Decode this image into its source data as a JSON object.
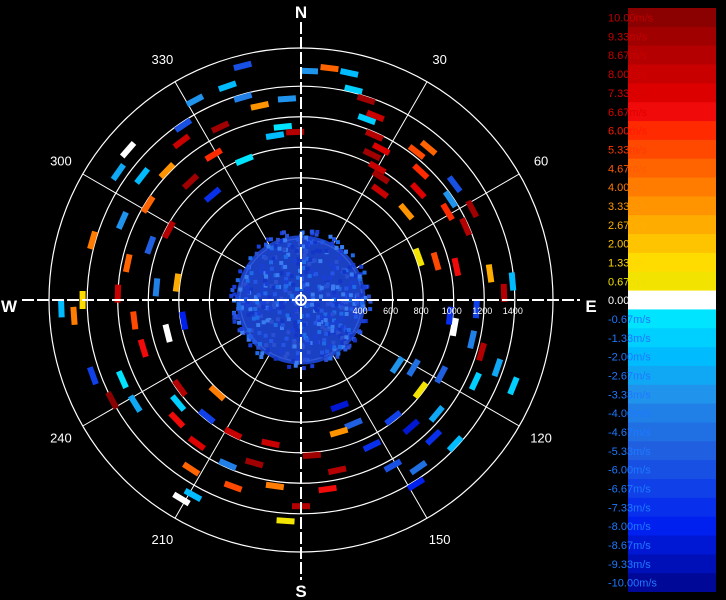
{
  "chart_data": {
    "type": "polar-scatter",
    "title": "",
    "cardinal_labels": {
      "north": "N",
      "east": "E",
      "south": "S",
      "west": "W"
    },
    "bearing_labels": [
      "30",
      "60",
      "120",
      "150",
      "210",
      "240",
      "300",
      "330"
    ],
    "bearing_values": [
      30,
      60,
      120,
      150,
      210,
      240,
      300,
      330
    ],
    "range_labels": [
      "400",
      "600",
      "800",
      "1000",
      "1200",
      "1400"
    ],
    "range_values": [
      400,
      600,
      800,
      1000,
      1200,
      1400
    ],
    "range_max": 1650,
    "grid": true,
    "colorbar": {
      "placement": "right",
      "labels": [
        "10.00m/s",
        "9.33m/s",
        "8.67m/s",
        "8.00m/s",
        "7.33m/s",
        "6.67m/s",
        "6.00m/s",
        "5.33m/s",
        "4.67m/s",
        "4.00m/s",
        "3.33m/s",
        "2.67m/s",
        "2.00m/s",
        "1.33m/s",
        "0.67m/s",
        "0.00m/s",
        "-0.67m/s",
        "-1.33m/s",
        "-2.00m/s",
        "-2.67m/s",
        "-3.33m/s",
        "-4.00m/s",
        "-4.67m/s",
        "-5.33m/s",
        "-6.00m/s",
        "-6.67m/s",
        "-7.33m/s",
        "-8.00m/s",
        "-8.67m/s",
        "-9.33m/s",
        "-10.00m/s"
      ],
      "colors": [
        "#8b0000",
        "#a00000",
        "#b40000",
        "#c80000",
        "#dc0000",
        "#f00a0a",
        "#ff2a00",
        "#ff4800",
        "#ff6400",
        "#ff7c00",
        "#ff9400",
        "#ffac00",
        "#ffc400",
        "#ffdc00",
        "#f2e400",
        "#ffffff",
        "#00e4ff",
        "#00d0ff",
        "#00bcff",
        "#10a8f4",
        "#2094ec",
        "#2080e8",
        "#2070e4",
        "#2060e0",
        "#1850e4",
        "#1040e8",
        "#0830ec",
        "#0020f0",
        "#0018d4",
        "#0010b8",
        "#000898"
      ]
    },
    "clutter_radius": 460,
    "gates": [
      {
        "az": 2,
        "r": 1500,
        "v": -3.3
      },
      {
        "az": 7,
        "r": 1530,
        "v": 5.0
      },
      {
        "az": 12,
        "r": 1520,
        "v": -2.2
      },
      {
        "az": 14,
        "r": 1420,
        "v": -1.5
      },
      {
        "az": 18,
        "r": 1380,
        "v": 9.5
      },
      {
        "az": 20,
        "r": 1260,
        "v": -1.4
      },
      {
        "az": 22,
        "r": 1300,
        "v": 7.8
      },
      {
        "az": 24,
        "r": 1180,
        "v": 8.9
      },
      {
        "az": 26,
        "r": 1060,
        "v": 9.1
      },
      {
        "az": 28,
        "r": 1120,
        "v": 7.2
      },
      {
        "az": 30,
        "r": 1000,
        "v": 8.3
      },
      {
        "az": 33,
        "r": 960,
        "v": 9.4
      },
      {
        "az": 36,
        "r": 880,
        "v": 8.1
      },
      {
        "az": 38,
        "r": 1230,
        "v": 5.4
      },
      {
        "az": 40,
        "r": 1300,
        "v": 4.6
      },
      {
        "az": 43,
        "r": 1150,
        "v": 6.2
      },
      {
        "az": 47,
        "r": 1050,
        "v": 7.6
      },
      {
        "az": 50,
        "r": 900,
        "v": 3.6
      },
      {
        "az": 53,
        "r": 1260,
        "v": -6.3
      },
      {
        "az": 56,
        "r": 1180,
        "v": -3.2
      },
      {
        "az": 59,
        "r": 1120,
        "v": 6.0
      },
      {
        "az": 62,
        "r": 1270,
        "v": 9.2
      },
      {
        "az": 66,
        "r": 1180,
        "v": 8.5
      },
      {
        "az": 70,
        "r": 820,
        "v": 0.6
      },
      {
        "az": 74,
        "r": 920,
        "v": 5.2
      },
      {
        "az": 78,
        "r": 1040,
        "v": 7.0
      },
      {
        "az": 82,
        "r": 1250,
        "v": 3.0
      },
      {
        "az": 85,
        "r": 1390,
        "v": -2.1
      },
      {
        "az": 88,
        "r": 1330,
        "v": 9.0
      },
      {
        "az": 93,
        "r": 1150,
        "v": -6.6
      },
      {
        "az": 96,
        "r": 980,
        "v": -7.1
      },
      {
        "az": 100,
        "r": 1020,
        "v": 0.0
      },
      {
        "az": 103,
        "r": 1150,
        "v": -4.1
      },
      {
        "az": 106,
        "r": 1230,
        "v": 8.4
      },
      {
        "az": 109,
        "r": 1360,
        "v": -2.4
      },
      {
        "az": 112,
        "r": 1500,
        "v": -1.3
      },
      {
        "az": 115,
        "r": 1260,
        "v": -1.6
      },
      {
        "az": 118,
        "r": 1040,
        "v": -5.1
      },
      {
        "az": 121,
        "r": 860,
        "v": -4.7
      },
      {
        "az": 124,
        "r": 760,
        "v": -3.0
      },
      {
        "az": 127,
        "r": 980,
        "v": 0.8
      },
      {
        "az": 130,
        "r": 1160,
        "v": -2.8
      },
      {
        "az": 133,
        "r": 1380,
        "v": -2.0
      },
      {
        "az": 136,
        "r": 1250,
        "v": -7.4
      },
      {
        "az": 139,
        "r": 1100,
        "v": -8.6
      },
      {
        "az": 142,
        "r": 980,
        "v": -6.7
      },
      {
        "az": 145,
        "r": 1340,
        "v": -4.4
      },
      {
        "az": 148,
        "r": 1420,
        "v": -8.1
      },
      {
        "az": 151,
        "r": 1240,
        "v": -6.2
      },
      {
        "az": 154,
        "r": 1060,
        "v": -7.6
      },
      {
        "az": 157,
        "r": 880,
        "v": -5.0
      },
      {
        "az": 160,
        "r": 740,
        "v": -8.8
      },
      {
        "az": 164,
        "r": 900,
        "v": 3.4
      },
      {
        "az": 168,
        "r": 1140,
        "v": 8.6
      },
      {
        "az": 172,
        "r": 1250,
        "v": 6.4
      },
      {
        "az": 176,
        "r": 1020,
        "v": 9.2
      },
      {
        "az": 180,
        "r": 1350,
        "v": 8.9
      },
      {
        "az": 184,
        "r": 1450,
        "v": 1.0
      },
      {
        "az": 188,
        "r": 1230,
        "v": 4.0
      },
      {
        "az": 192,
        "r": 960,
        "v": 7.7
      },
      {
        "az": 196,
        "r": 1110,
        "v": 9.6
      },
      {
        "az": 200,
        "r": 1300,
        "v": 5.6
      },
      {
        "az": 204,
        "r": 1180,
        "v": -4.2
      },
      {
        "az": 207,
        "r": 980,
        "v": 8.2
      },
      {
        "az": 209,
        "r": 1460,
        "v": -1.9
      },
      {
        "az": 211,
        "r": 1520,
        "v": 0.0
      },
      {
        "az": 213,
        "r": 1320,
        "v": 4.8
      },
      {
        "az": 216,
        "r": 1160,
        "v": 7.4
      },
      {
        "az": 219,
        "r": 980,
        "v": -6.8
      },
      {
        "az": 222,
        "r": 820,
        "v": 4.2
      },
      {
        "az": 226,
        "r": 1130,
        "v": 6.6
      },
      {
        "az": 230,
        "r": 1050,
        "v": -1.0
      },
      {
        "az": 234,
        "r": 980,
        "v": 8.7
      },
      {
        "az": 238,
        "r": 1280,
        "v": -2.6
      },
      {
        "az": 242,
        "r": 1400,
        "v": 9.8
      },
      {
        "az": 246,
        "r": 1280,
        "v": -0.8
      },
      {
        "az": 250,
        "r": 1450,
        "v": -6.5
      },
      {
        "az": 253,
        "r": 1080,
        "v": 6.9
      },
      {
        "az": 256,
        "r": 900,
        "v": 0.2
      },
      {
        "az": 260,
        "r": 780,
        "v": -7.8
      },
      {
        "az": 263,
        "r": 1100,
        "v": 5.1
      },
      {
        "az": 266,
        "r": 1490,
        "v": 3.8
      },
      {
        "az": 268,
        "r": 1570,
        "v": -2.0
      },
      {
        "az": 270,
        "r": 1430,
        "v": 1.6
      },
      {
        "az": 272,
        "r": 1200,
        "v": 7.9
      },
      {
        "az": 275,
        "r": 950,
        "v": -3.9
      },
      {
        "az": 278,
        "r": 820,
        "v": 2.8
      },
      {
        "az": 282,
        "r": 1160,
        "v": 4.5
      },
      {
        "az": 286,
        "r": 1420,
        "v": 3.9
      },
      {
        "az": 290,
        "r": 1050,
        "v": -5.6
      },
      {
        "az": 294,
        "r": 1280,
        "v": -3.6
      },
      {
        "az": 298,
        "r": 980,
        "v": 8.8
      },
      {
        "az": 302,
        "r": 1180,
        "v": 4.9
      },
      {
        "az": 305,
        "r": 1460,
        "v": -2.9
      },
      {
        "az": 308,
        "r": 1320,
        "v": -1.7
      },
      {
        "az": 311,
        "r": 1500,
        "v": 0.0
      },
      {
        "az": 314,
        "r": 1220,
        "v": 3.1
      },
      {
        "az": 317,
        "r": 1060,
        "v": 9.1
      },
      {
        "az": 320,
        "r": 900,
        "v": -7.5
      },
      {
        "az": 323,
        "r": 1300,
        "v": 8.0
      },
      {
        "az": 326,
        "r": 1380,
        "v": -5.8
      },
      {
        "az": 329,
        "r": 1110,
        "v": 6.3
      },
      {
        "az": 332,
        "r": 1480,
        "v": -3.4
      },
      {
        "az": 335,
        "r": 1250,
        "v": 9.3
      },
      {
        "az": 338,
        "r": 990,
        "v": -0.9
      },
      {
        "az": 341,
        "r": 1480,
        "v": -2.3
      },
      {
        "az": 344,
        "r": 1380,
        "v": -4.0
      },
      {
        "az": 346,
        "r": 1580,
        "v": -6.0
      },
      {
        "az": 348,
        "r": 1300,
        "v": 3.5
      },
      {
        "az": 351,
        "r": 1090,
        "v": -2.1
      },
      {
        "az": 354,
        "r": 1140,
        "v": -0.7
      },
      {
        "az": 356,
        "r": 1320,
        "v": -3.1
      },
      {
        "az": 358,
        "r": 1100,
        "v": 8.7
      }
    ]
  }
}
